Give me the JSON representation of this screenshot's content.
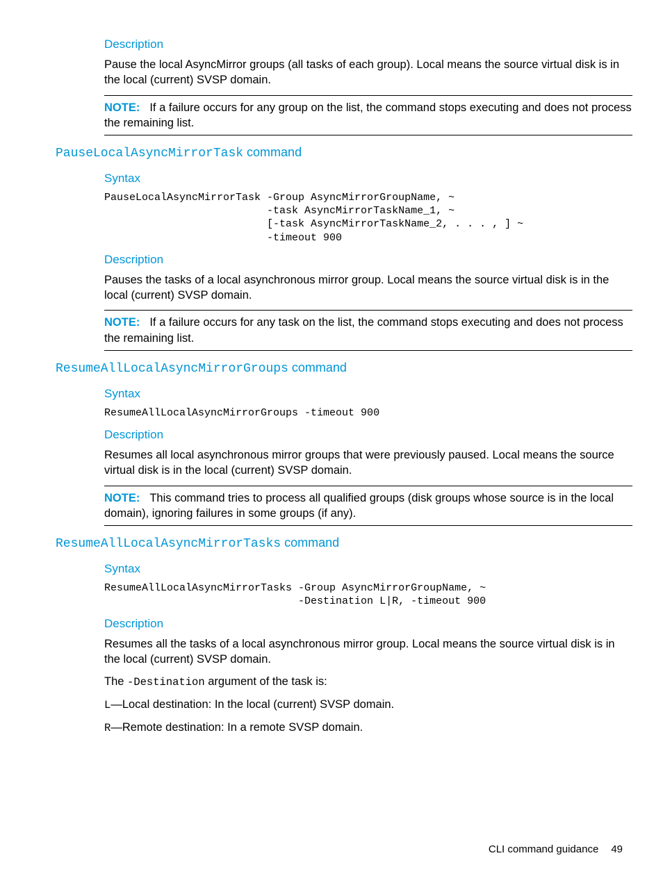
{
  "colors": {
    "accent": "#0096d6"
  },
  "sec0": {
    "desc_h": "Description",
    "desc": "Pause the local AsyncMirror groups (all tasks of each group). Local means the source virtual disk is in the local (current) SVSP domain.",
    "note_label": "NOTE:",
    "note": "If a failure occurs for any group on the list, the command stops executing and does not process the remaining list."
  },
  "sec1": {
    "title_cmd": "PauseLocalAsyncMirrorTask",
    "title_word": " command",
    "syntax_h": "Syntax",
    "code": "PauseLocalAsyncMirrorTask -Group AsyncMirrorGroupName, ~\n                          -task AsyncMirrorTaskName_1, ~\n                          [-task AsyncMirrorTaskName_2, . . . , ] ~\n                          -timeout 900",
    "desc_h": "Description",
    "desc": "Pauses the tasks of a local asynchronous mirror group. Local means the source virtual disk is in the local (current) SVSP domain.",
    "note_label": "NOTE:",
    "note": "If a failure occurs for any task on the list, the command stops executing and does not process the remaining list."
  },
  "sec2": {
    "title_cmd": "ResumeAllLocalAsyncMirrorGroups",
    "title_word": " command",
    "syntax_h": "Syntax",
    "code": "ResumeAllLocalAsyncMirrorGroups -timeout 900",
    "desc_h": "Description",
    "desc": "Resumes all local asynchronous mirror groups that were previously paused. Local means the source virtual disk is in the local (current) SVSP domain.",
    "note_label": "NOTE:",
    "note": "This command tries to process all qualified groups (disk groups whose source is in the local domain), ignoring failures in some groups (if any)."
  },
  "sec3": {
    "title_cmd": "ResumeAllLocalAsyncMirrorTasks",
    "title_word": " command",
    "syntax_h": "Syntax",
    "code": "ResumeAllLocalAsyncMirrorTasks -Group AsyncMirrorGroupName, ~\n                               -Destination L|R, -timeout 900",
    "desc_h": "Description",
    "desc": "Resumes all the tasks of a local asynchronous mirror group. Local means the source virtual disk is in the local (current) SVSP domain.",
    "dest_pre": "The ",
    "dest_code": "-Destination",
    "dest_post": " argument of the task is:",
    "l_code": "L",
    "l_text": "—Local destination: In the local (current) SVSP domain.",
    "r_code": "R",
    "r_text": "—Remote destination: In a remote SVSP domain."
  },
  "footer": {
    "text": "CLI command guidance",
    "page": "49"
  }
}
